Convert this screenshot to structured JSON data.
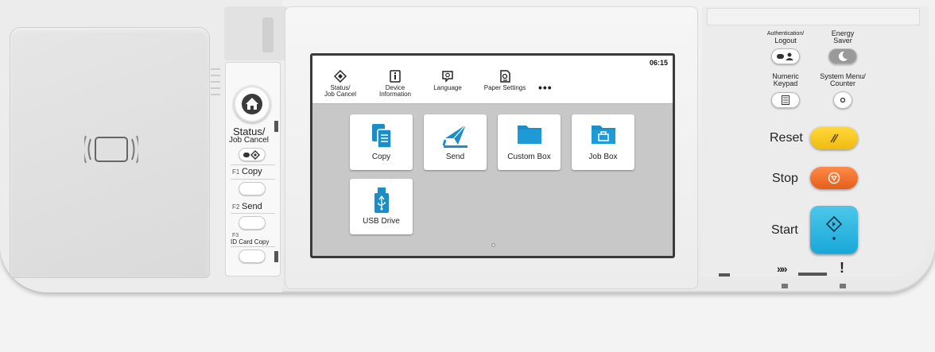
{
  "screen": {
    "clock": "06:15",
    "topbar": [
      {
        "id": "status",
        "line1": "Status/",
        "line2": "Job Cancel",
        "icon": "status-diamond-icon"
      },
      {
        "id": "device",
        "line1": "Device",
        "line2": "Information",
        "icon": "device-info-icon"
      },
      {
        "id": "language",
        "line1": "Language",
        "line2": "",
        "icon": "language-icon"
      },
      {
        "id": "paper",
        "line1": "Paper Settings",
        "line2": "",
        "icon": "paper-settings-icon"
      }
    ],
    "more": "•••",
    "tiles": [
      {
        "label": "Copy",
        "icon": "copy-icon"
      },
      {
        "label": "Send",
        "icon": "send-icon"
      },
      {
        "label": "Custom Box",
        "icon": "folder-icon"
      },
      {
        "label": "Job Box",
        "icon": "job-box-icon"
      },
      {
        "label": "USB Drive",
        "icon": "usb-drive-icon"
      }
    ],
    "accent": "#1b8ec8"
  },
  "left_keys": {
    "status_line1": "Status/",
    "status_line2": "Job Cancel",
    "f1_num": "F1",
    "f1_label": "Copy",
    "f2_num": "F2",
    "f2_label": "Send",
    "f3_num": "F3",
    "f3_label": "ID Card Copy"
  },
  "right_keys": {
    "auth_line1": "Authentication/",
    "auth_line2": "Logout",
    "energy_line1": "Energy",
    "energy_line2": "Saver",
    "numeric_line1": "Numeric",
    "numeric_line2": "Keypad",
    "sysmenu_line1": "System Menu/",
    "sysmenu_line2": "Counter",
    "reset": "Reset",
    "stop": "Stop",
    "start": "Start",
    "processing_indicator": "»»",
    "attention_indicator": "!"
  },
  "colors": {
    "reset_key": "#f5c518",
    "stop_key": "#f07028",
    "start_key": "#25b3e0"
  }
}
